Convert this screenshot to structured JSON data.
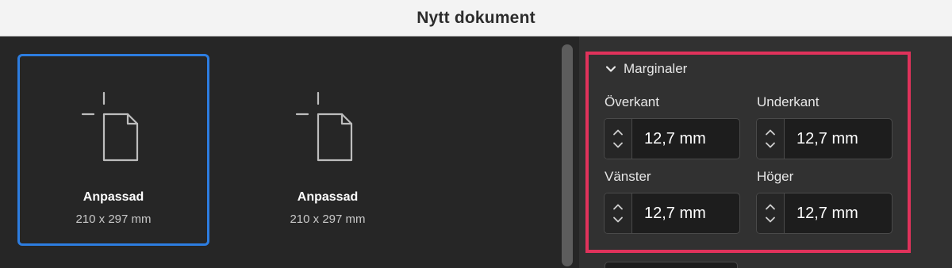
{
  "window": {
    "title": "Nytt dokument"
  },
  "presets": [
    {
      "name": "Anpassad",
      "size": "210 x 297 mm",
      "selected": true,
      "icon": "blank-document-icon"
    },
    {
      "name": "Anpassad",
      "size": "210 x 297 mm",
      "selected": false,
      "icon": "blank-document-icon"
    }
  ],
  "margins": {
    "header": "Marginaler",
    "header_icon": "chevron-down-icon",
    "top_label": "Överkant",
    "top_value": "12,7 mm",
    "bottom_label": "Underkant",
    "bottom_value": "12,7 mm",
    "left_label": "Vänster",
    "left_value": "12,7 mm",
    "right_label": "Höger",
    "right_value": "12,7 mm"
  },
  "colors": {
    "selection_border": "#2d7de0",
    "highlight_border": "#e0325b"
  }
}
